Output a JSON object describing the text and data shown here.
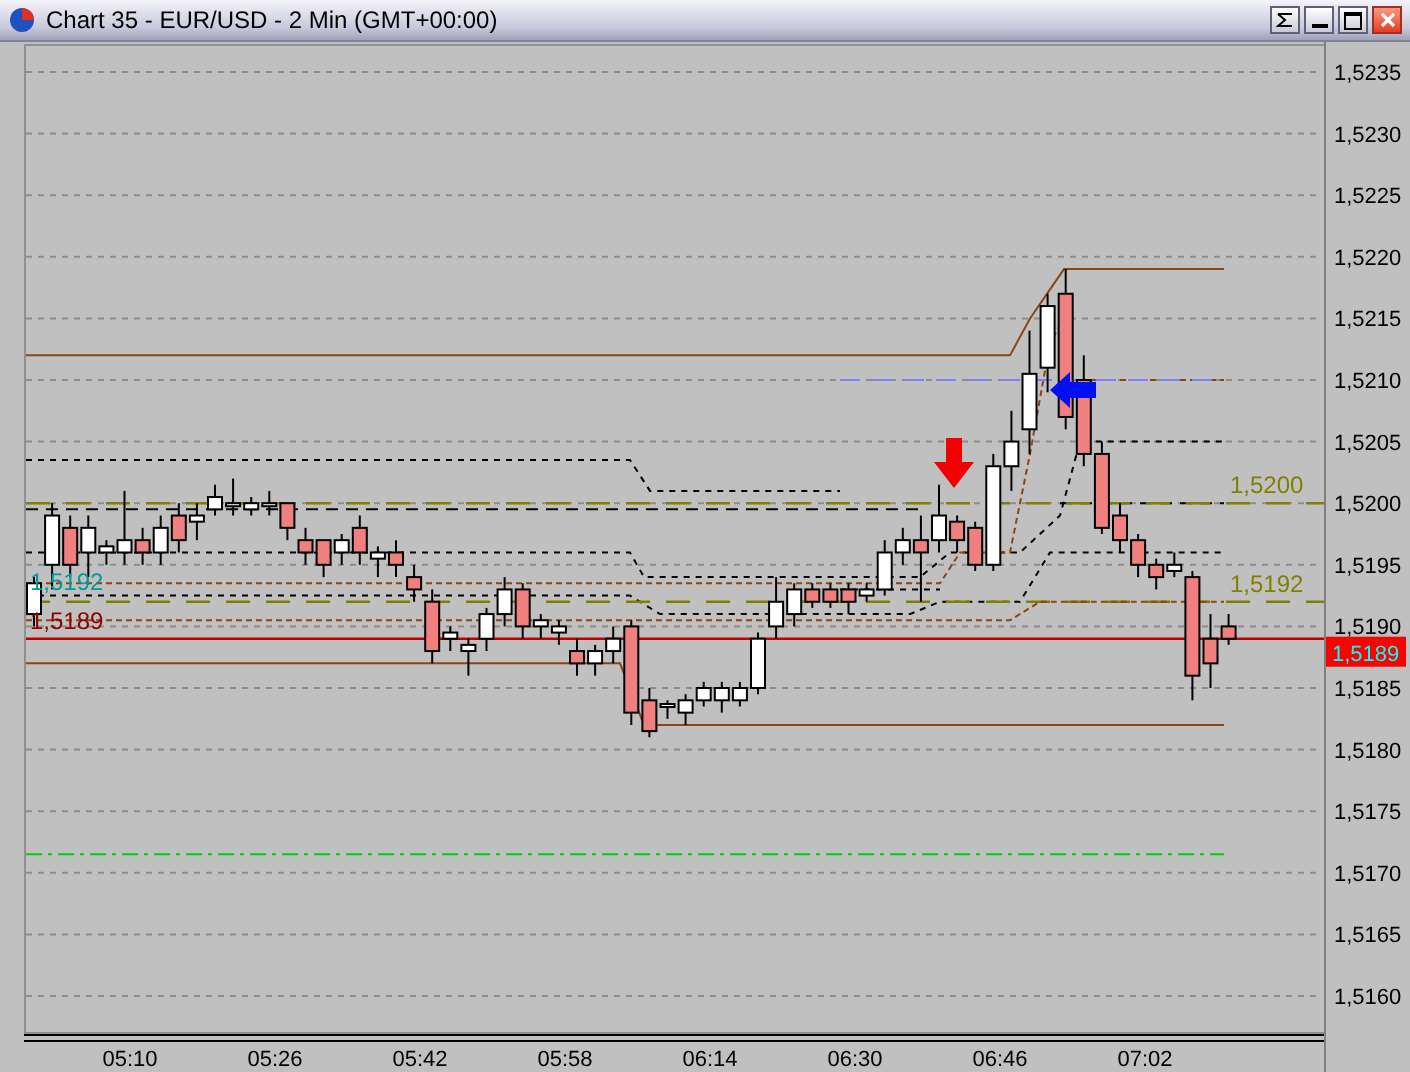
{
  "window": {
    "title": "Chart 35 - EUR/USD - 2 Min (GMT+00:00)"
  },
  "price_axis": {
    "ticks": [
      "1,5235",
      "1,5230",
      "1,5225",
      "1,5220",
      "1,5215",
      "1,5210",
      "1,5205",
      "1,5200",
      "1,5195",
      "1,5190",
      "1,5185",
      "1,5180",
      "1,5175",
      "1,5170",
      "1,5165",
      "1,5160"
    ],
    "current_price": "1,5189"
  },
  "time_axis": {
    "ticks": [
      "05:10",
      "05:26",
      "05:42",
      "05:58",
      "06:14",
      "06:30",
      "06:46",
      "07:02"
    ]
  },
  "chart_labels": [
    {
      "text": "1,5200",
      "kind": "level"
    },
    {
      "text": "1,5192",
      "kind": "marker"
    },
    {
      "text": "1,5192",
      "kind": "level"
    },
    {
      "text": "1,5189",
      "kind": "last"
    }
  ]
}
